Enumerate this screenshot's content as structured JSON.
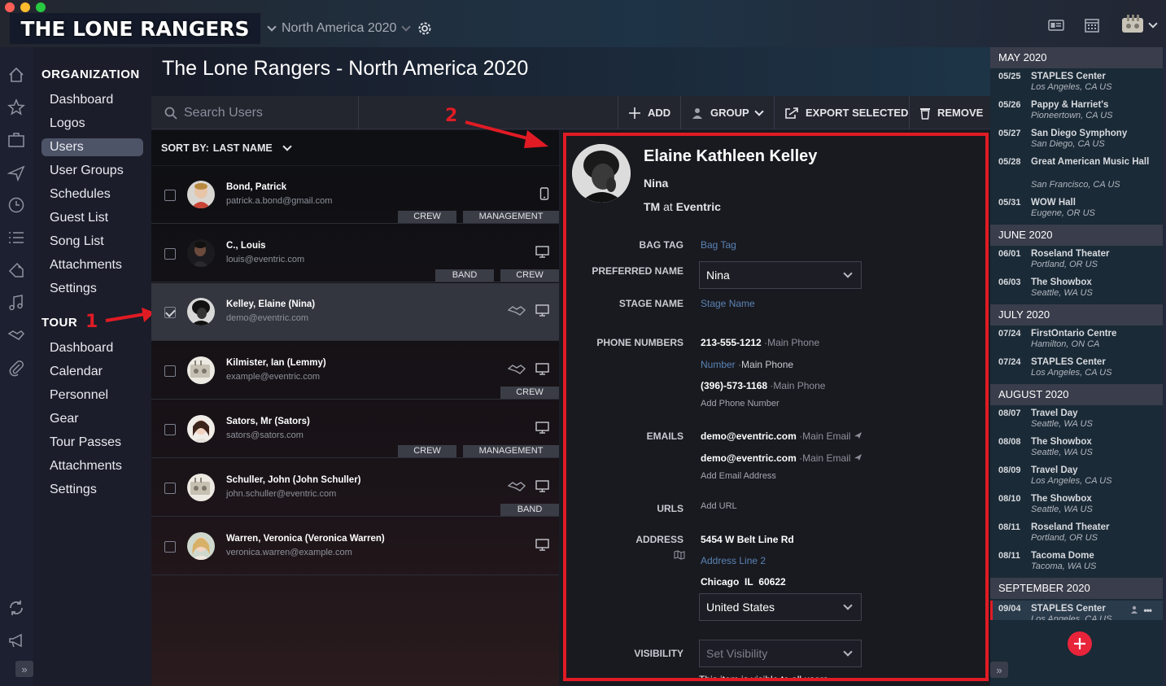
{
  "app": {
    "logo_text": "THE LONE RANGERS",
    "tour_selector": "North America 2020",
    "page_title": "The Lone Rangers - North America 2020"
  },
  "colors": {
    "accent_red": "#e01b24",
    "fab": "#e8243a",
    "nav_active": "#4e5468",
    "placeholder_link": "#5a83b5"
  },
  "nav": {
    "organization_heading": "ORGANIZATION",
    "organization_items": [
      "Dashboard",
      "Logos",
      "Users",
      "User Groups",
      "Schedules",
      "Guest List",
      "Song List",
      "Attachments",
      "Settings"
    ],
    "active_item": "Users",
    "tour_heading": "TOUR",
    "tour_items": [
      "Dashboard",
      "Calendar",
      "Personnel",
      "Gear",
      "Tour Passes",
      "Attachments",
      "Settings"
    ]
  },
  "annotations": {
    "marker_1": "1",
    "marker_2": "2"
  },
  "toolbar": {
    "search_placeholder": "Search Users",
    "add_label": "ADD",
    "group_label": "GROUP",
    "export_label": "EXPORT SELECTED",
    "remove_label": "REMOVE"
  },
  "sort": {
    "label": "SORT BY:",
    "value": "LAST NAME"
  },
  "users": [
    {
      "name": "Bond, Patrick",
      "email": "patrick.a.bond@gmail.com",
      "tags": [
        "CREW",
        "MANAGEMENT"
      ],
      "checked": false,
      "device": "phone-icon"
    },
    {
      "name": "C., Louis",
      "email": "louis@eventric.com",
      "tags": [
        "BAND",
        "CREW"
      ],
      "checked": false,
      "device": "desktop-icon"
    },
    {
      "name": "Kelley, Elaine (Nina)",
      "email": "demo@eventric.com",
      "tags": [],
      "checked": true,
      "device": "desktop-icon"
    },
    {
      "name": "Kilmister, Ian (Lemmy)",
      "email": "example@eventric.com",
      "tags": [
        "CREW"
      ],
      "checked": false,
      "device": "desktop-icon"
    },
    {
      "name": "Sators, Mr (Sators)",
      "email": "sators@sators.com",
      "tags": [
        "CREW",
        "MANAGEMENT"
      ],
      "checked": false,
      "device": "desktop-icon"
    },
    {
      "name": "Schuller, John (John Schuller)",
      "email": "john.schuller@eventric.com",
      "tags": [
        "BAND"
      ],
      "checked": false,
      "device": "desktop-icon"
    },
    {
      "name": "Warren, Veronica (Veronica Warren)",
      "email": "veronica.warren@example.com",
      "tags": [],
      "checked": false,
      "device": "desktop-icon"
    }
  ],
  "detail": {
    "full_name": "Elaine Kathleen Kelley",
    "nickname": "Nina",
    "role": "TM",
    "role_at": "at",
    "company": "Eventric",
    "labels": {
      "bag_tag": "BAG TAG",
      "preferred_name": "PREFERRED NAME",
      "stage_name": "STAGE NAME",
      "phone_numbers": "PHONE NUMBERS",
      "emails": "EMAILS",
      "urls": "URLS",
      "address": "ADDRESS",
      "visibility": "VISIBILITY"
    },
    "bag_tag_placeholder": "Bag Tag",
    "preferred_name_value": "Nina",
    "stage_name_placeholder": "Stage Name",
    "phones": [
      {
        "number": "213-555-1212",
        "type": "Main Phone",
        "placeholder": false
      },
      {
        "number": "Number",
        "type": "Main Phone",
        "placeholder": true
      },
      {
        "number": "(396)-573-1168",
        "type": "Main Phone",
        "placeholder": false
      }
    ],
    "add_phone": "Add Phone Number",
    "emails": [
      {
        "address": "demo@eventric.com",
        "type": "Main Email"
      },
      {
        "address": "demo@eventric.com",
        "type": "Main Email"
      }
    ],
    "add_email": "Add Email Address",
    "add_url": "Add URL",
    "address_line1": "5454 W Belt Line Rd",
    "address_line2_placeholder": "Address Line 2",
    "city": "Chicago",
    "state": "IL",
    "zip": "60622",
    "country": "United States",
    "visibility_placeholder": "Set Visibility",
    "visibility_note": "This item is visible to all users."
  },
  "schedule": [
    {
      "month": "MAY 2020",
      "events": [
        {
          "date": "05/25",
          "name": "STAPLES Center",
          "location": "Los Angeles, CA US"
        },
        {
          "date": "05/26",
          "name": "Pappy & Harriet's",
          "location": "Pioneertown, CA US"
        },
        {
          "date": "05/27",
          "name": "San Diego Symphony",
          "location": "San Diego, CA US"
        },
        {
          "date": "05/28",
          "name": "Great American Music Hall",
          "location": "San Francisco, CA US"
        },
        {
          "date": "05/31",
          "name": "WOW Hall",
          "location": "Eugene, OR US"
        }
      ]
    },
    {
      "month": "JUNE 2020",
      "events": [
        {
          "date": "06/01",
          "name": "Roseland Theater",
          "location": "Portland, OR US"
        },
        {
          "date": "06/03",
          "name": "The Showbox",
          "location": "Seattle, WA US"
        }
      ]
    },
    {
      "month": "JULY 2020",
      "events": [
        {
          "date": "07/24",
          "name": "FirstOntario Centre",
          "location": "Hamilton, ON CA"
        },
        {
          "date": "07/24",
          "name": "STAPLES Center",
          "location": "Los Angeles, CA US"
        }
      ]
    },
    {
      "month": "AUGUST 2020",
      "events": [
        {
          "date": "08/07",
          "name": "Travel Day",
          "location": "Seattle, WA US"
        },
        {
          "date": "08/08",
          "name": "The Showbox",
          "location": "Seattle, WA US"
        },
        {
          "date": "08/09",
          "name": "Travel Day",
          "location": "Los Angeles, CA US"
        },
        {
          "date": "08/10",
          "name": "The Showbox",
          "location": "Seattle, WA US"
        },
        {
          "date": "08/11",
          "name": "Roseland Theater",
          "location": "Portland, OR US"
        },
        {
          "date": "08/11",
          "name": "Tacoma Dome",
          "location": "Tacoma, WA US"
        }
      ]
    },
    {
      "month": "SEPTEMBER 2020",
      "events": [
        {
          "date": "09/04",
          "name": "STAPLES Center",
          "location": "Los Angeles, CA US"
        }
      ]
    }
  ]
}
